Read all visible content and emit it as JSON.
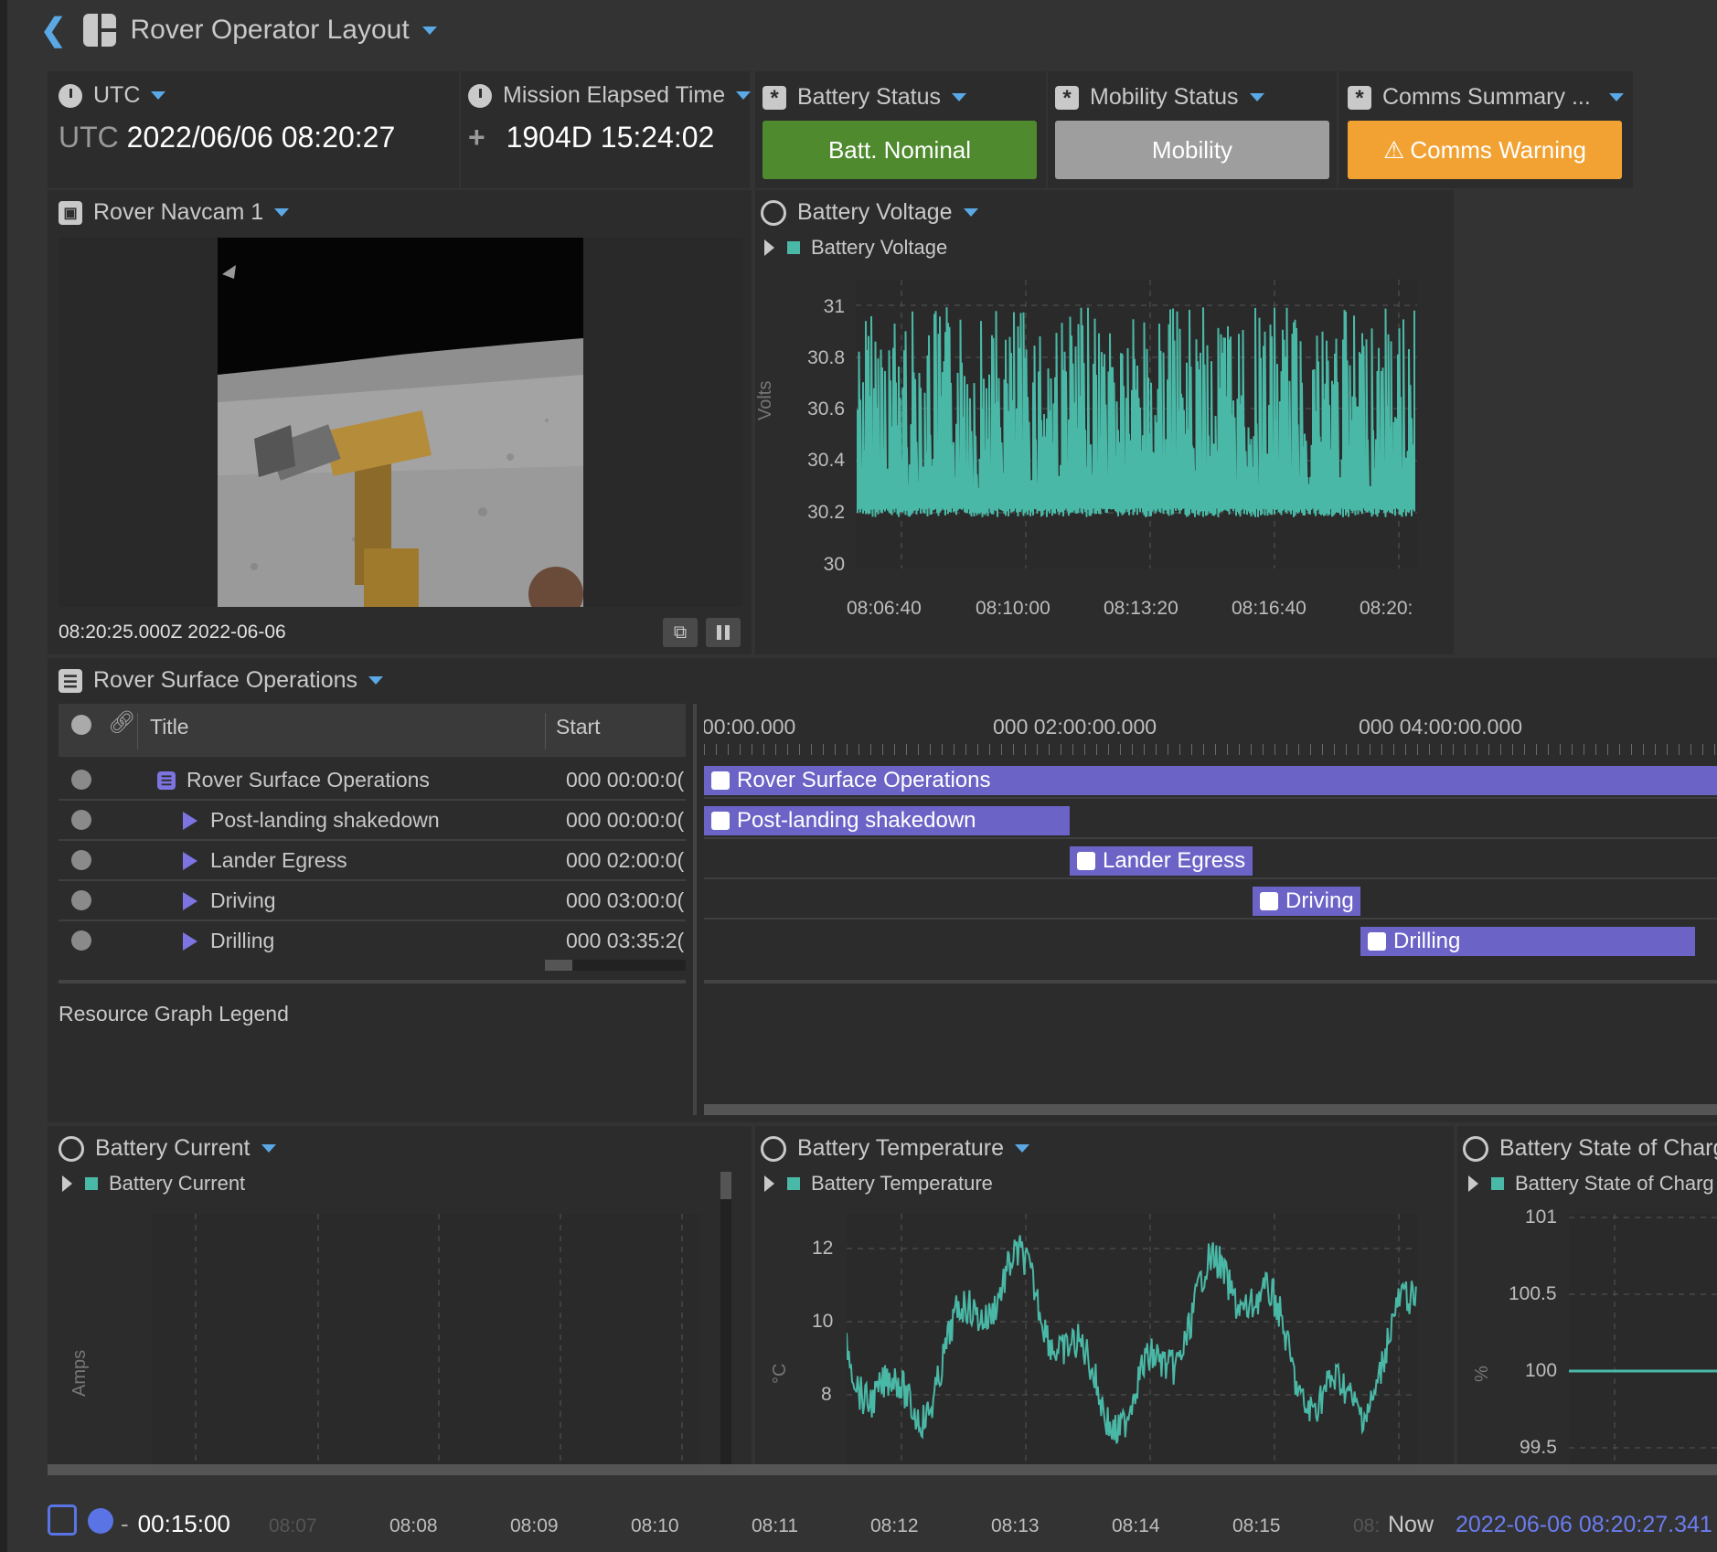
{
  "header": {
    "title": "Rover Operator Layout"
  },
  "utc": {
    "label": "UTC",
    "prefix": "UTC",
    "value": "2022/06/06 08:20:27"
  },
  "met": {
    "label": "Mission Elapsed Time",
    "value": "1904D 15:24:02"
  },
  "status": [
    {
      "label": "Battery Status",
      "button": "Batt. Nominal",
      "color": "#4f8a2f"
    },
    {
      "label": "Mobility Status",
      "button": "Mobility",
      "color": "#9e9e9e"
    },
    {
      "label": "Comms Summary ...",
      "button": "Comms Warning",
      "color": "#f2a233"
    }
  ],
  "navcam": {
    "label": "Rover Navcam 1",
    "timestamp": "08:20:25.000Z 2022-06-06"
  },
  "battery_voltage": {
    "label": "Battery Voltage",
    "legend": "Battery Voltage",
    "ylabel": "Volts",
    "yticks": [
      "31",
      "30.8",
      "30.6",
      "30.4",
      "30.2",
      "30"
    ],
    "xticks": [
      "08:06:40",
      "08:10:00",
      "08:13:20",
      "08:16:40",
      "08:20:"
    ]
  },
  "operations": {
    "label": "Rover Surface Operations",
    "columns": {
      "title": "Title",
      "start": "Start"
    },
    "rows": [
      {
        "title": "Rover Surface Operations",
        "start": "000 00:00:0("
      },
      {
        "title": "Post-landing shakedown",
        "start": "000 00:00:0("
      },
      {
        "title": "Lander Egress",
        "start": "000 02:00:0("
      },
      {
        "title": "Driving",
        "start": "000 03:00:0("
      },
      {
        "title": "Drilling",
        "start": "000 03:35:2("
      }
    ],
    "timeline_ticks": [
      "00:00.000",
      "000 02:00:00.000",
      "000 04:00:00.000"
    ],
    "bars": [
      "Rover Surface Operations",
      "Post-landing shakedown",
      "Lander Egress",
      "Driving",
      "Drilling"
    ],
    "legend_title": "Resource Graph Legend"
  },
  "battery_current": {
    "label": "Battery Current",
    "legend": "Battery Current",
    "ylabel": "Amps"
  },
  "battery_temperature": {
    "label": "Battery Temperature",
    "legend": "Battery Temperature",
    "ylabel": "°C",
    "yticks": [
      "12",
      "10",
      "8"
    ]
  },
  "battery_soc": {
    "label": "Battery State of Charg",
    "legend": "Battery State of Charg",
    "ylabel": "%",
    "yticks": [
      "101",
      "100.5",
      "100",
      "99.5"
    ]
  },
  "timebar": {
    "duration": "00:15:00",
    "ticks": [
      "08:07",
      "08:08",
      "08:09",
      "08:10",
      "08:11",
      "08:12",
      "08:13",
      "08:14",
      "08:15",
      "08:"
    ],
    "now_label": "Now",
    "now_value": "2022-06-06 08:20:27.341"
  },
  "colors": {
    "accent": "#5aa9e6",
    "series": "#4ab8a6",
    "bar": "#6c63c7"
  }
}
